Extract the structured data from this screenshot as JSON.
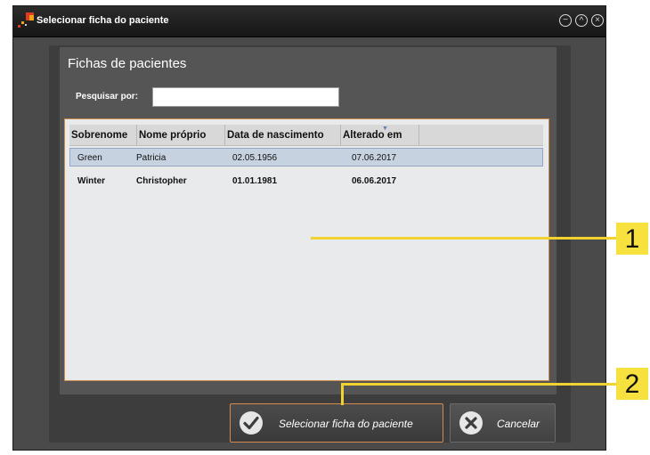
{
  "window": {
    "title": "Selecionar ficha do paciente",
    "controls": [
      "minimize-icon",
      "maximize-icon",
      "close-icon"
    ],
    "minimize_glyph": "−",
    "maximize_glyph": "^",
    "close_glyph": "×"
  },
  "panel": {
    "title": "Fichas de pacientes",
    "search_label": "Pesquisar por:",
    "search_value": "",
    "search_placeholder": ""
  },
  "table": {
    "columns": [
      "Sobrenome",
      "Nome próprio",
      "Data de nascimento",
      "Alterado em"
    ],
    "sorted_column": "Alterado em",
    "rows": [
      {
        "surname": "Green",
        "first_name": "Patricia",
        "birth_date": "02.05.1956",
        "modified": "07.06.2017",
        "selected": true
      },
      {
        "surname": "Winter",
        "first_name": "Christopher",
        "birth_date": "01.01.1981",
        "modified": "06.06.2017",
        "selected": false
      }
    ]
  },
  "buttons": {
    "select": "Selecionar ficha do paciente",
    "cancel": "Cancelar"
  },
  "callouts": [
    "1",
    "2"
  ],
  "colors": {
    "callout": "#f7e13e",
    "active_border": "#d48a4e",
    "selected_row": "#c7d2e0"
  }
}
